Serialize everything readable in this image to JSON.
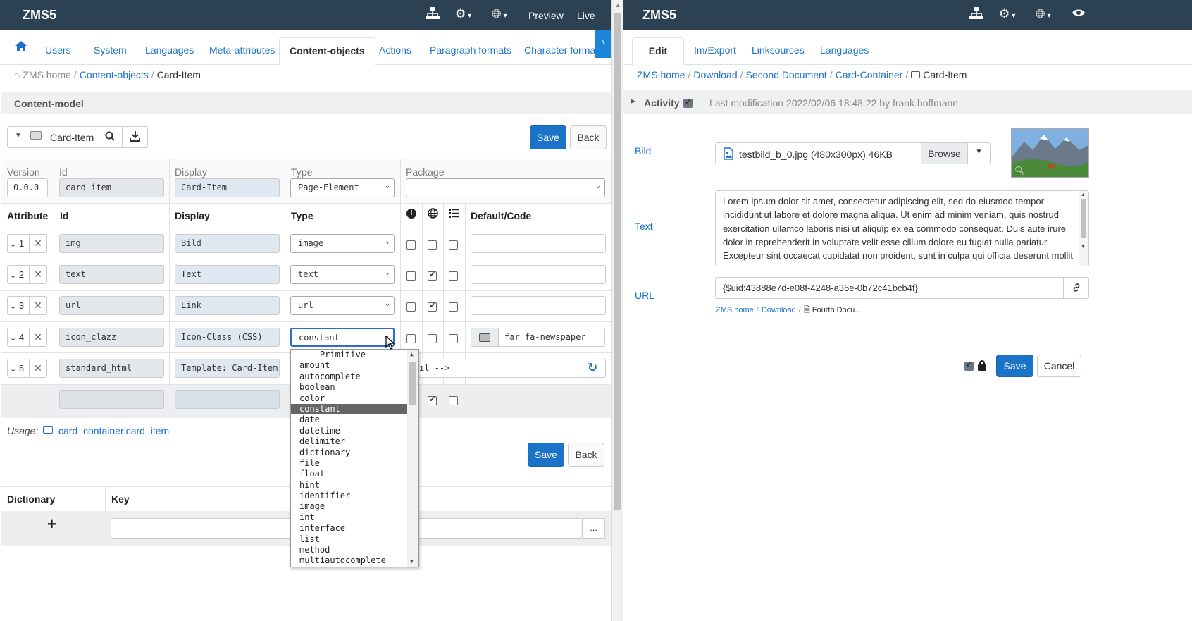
{
  "left": {
    "brand": "ZMS5",
    "top_links": {
      "preview": "Preview",
      "live": "Live"
    },
    "tabs": [
      "Users",
      "System",
      "Languages",
      "Meta-attributes",
      "Content-objects",
      "Actions",
      "Paragraph formats",
      "Character formats"
    ],
    "active_tab": "Content-objects",
    "breadcrumb": {
      "home": "ZMS home",
      "level1": "Content-objects",
      "current": "Card-Item"
    },
    "section_title": "Content-model",
    "object_selector": "Card-Item",
    "buttons": {
      "save": "Save",
      "back": "Back"
    },
    "meta_labels": {
      "version": "Version",
      "id": "Id",
      "display": "Display",
      "type": "Type",
      "package": "Package"
    },
    "meta_values": {
      "version": "0.0.0",
      "id": "card_item",
      "display": "Card-Item",
      "type": "Page-Element",
      "package": ""
    },
    "table_headers": {
      "attribute": "Attribute",
      "id": "Id",
      "display": "Display",
      "type": "Type",
      "default": "Default/Code"
    },
    "attributes": [
      {
        "num": "1",
        "id": "img",
        "display": "Bild",
        "type": "image",
        "c1": false,
        "c2": false,
        "c3": false
      },
      {
        "num": "2",
        "id": "text",
        "display": "Text",
        "type": "text",
        "c1": false,
        "c2": true,
        "c3": false
      },
      {
        "num": "3",
        "id": "url",
        "display": "Link",
        "type": "url",
        "c1": false,
        "c2": true,
        "c3": false
      },
      {
        "num": "4",
        "id": "icon_clazz",
        "display": "Icon-Class (CSS)",
        "type": "constant",
        "c1": false,
        "c2": false,
        "c3": false,
        "default": "far fa-newspaper"
      },
      {
        "num": "5",
        "id": "standard_html",
        "display": "Template: Card-Item",
        "default": "ıl -->"
      }
    ],
    "usage_label": "Usage:",
    "usage_link": "card_container.card_item",
    "dict_headers": {
      "dictionary": "Dictionary",
      "key": "Key"
    },
    "dict_add": "+",
    "dict_more": "...",
    "type_dropdown": {
      "options": [
        "--- Primitive ---",
        "amount",
        "autocomplete",
        "boolean",
        "color",
        "constant",
        "date",
        "datetime",
        "delimiter",
        "dictionary",
        "file",
        "float",
        "hint",
        "identifier",
        "image",
        "int",
        "interface",
        "list",
        "method",
        "multiautocomplete"
      ],
      "selected": "constant"
    }
  },
  "right": {
    "brand": "ZMS5",
    "tabs": [
      "Edit",
      "Im/Export",
      "Linksources",
      "Languages"
    ],
    "active_tab": "Edit",
    "breadcrumb": [
      "ZMS home",
      "Download",
      "Second Document",
      "Card-Container"
    ],
    "breadcrumb_current": "Card-Item",
    "activity_label": "Activity",
    "last_modification": "Last modification 2022/02/06 18:48:22 by frank.hoffmann",
    "fields": {
      "bild_label": "Bild",
      "bild_file": "testbild_b_0.jpg (480x300px) 46KB",
      "browse": "Browse",
      "text_label": "Text",
      "text_value": "Lorem ipsum dolor sit amet, consectetur adipiscing elit, sed do eiusmod tempor incididunt ut labore et dolore magna aliqua. Ut enim ad minim veniam, quis nostrud exercitation ullamco laboris nisi ut aliquip ex ea commodo consequat. Duis aute irure dolor in reprehenderit in voluptate velit esse cillum dolore eu fugiat nulla pariatur. Excepteur sint occaecat cupidatat non proident, sunt in culpa qui officia deserunt mollit",
      "url_label": "URL",
      "url_value": "{$uid:43888e7d-e08f-4248-a36e-0b72c41bcb4f}",
      "url_path": [
        "ZMS home",
        "Download"
      ],
      "url_path_current": "Fourth Docu..."
    },
    "buttons": {
      "save": "Save",
      "cancel": "Cancel"
    }
  }
}
